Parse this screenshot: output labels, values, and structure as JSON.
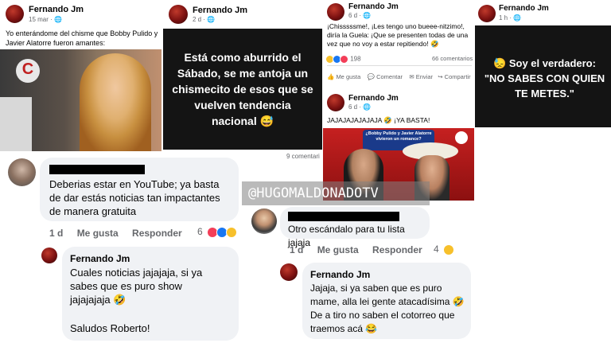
{
  "posts": {
    "p1": {
      "author": "Fernando Jm",
      "time": "15 mar · ",
      "text": "Yo enterándome del chisme que Bobby Pulido y Javier Alatorre fueron amantes:",
      "tv_logo": "C"
    },
    "p2": {
      "author": "Fernando Jm",
      "time": "2 d · ",
      "text": "Está como aburrido el Sábado, se me antoja un chismecito de esos que se vuelven tendencia nacional 😅",
      "footer": "9 comentari"
    },
    "p3": {
      "author": "Fernando Jm",
      "time": "6 d · ",
      "text": "¡Chisssssme!, ¡Les tengo uno bueee-nitzimo!, diría la Guela: ¡Que se presenten todas de una vez que no voy a estar repitiendo! 🤣",
      "reactions": "198",
      "comments": "66 comentarios",
      "actions": [
        "Me gusta",
        "Comentar",
        "Enviar",
        "Compartir"
      ]
    },
    "p4": {
      "author": "Fernando Jm",
      "time": "6 d · ",
      "text": "JAJAJAJAJAJAJA 🤣 ¡YA BASTA!",
      "thumb_caption": "¿Bobby Pulido y Javier Alatorre vivieron un romance?"
    },
    "p5": {
      "author": "Fernando Jm",
      "time": "1 h · ",
      "text": "😓 Soy el verdadero: \"NO SABES CON QUIEN TE METES.\""
    }
  },
  "watermark": "@HUGOMALDONADOTV",
  "comments": {
    "c1": {
      "text": "Deberias estar en YouTube; ya basta de dar estás noticias tan impactantes de manera gratuita",
      "time": "1 d",
      "like": "Me gusta",
      "reply": "Responder",
      "count": "6"
    },
    "r1": {
      "author": "Fernando Jm",
      "text": "Cuales noticias jajajaja, si ya sabes que es puro show jajajajaja 🤣",
      "text2": "Saludos Roberto!"
    },
    "c2": {
      "text": "Otro escándalo para tu lista jajaja",
      "time": "1 d",
      "like": "Me gusta",
      "reply": "Responder",
      "count": "4"
    },
    "r2": {
      "author": "Fernando Jm",
      "text": "Jajaja, si ya saben que es puro mame, alla lei gente atacadísima 🤣 De a tiro no saben el cotorreo que traemos acá 😂"
    }
  },
  "colors": {
    "dark_card": "#141414",
    "bubble": "#f0f2f5",
    "like_blue": "#1877f2",
    "haha_yellow": "#f7c02b",
    "love_red": "#f33e58"
  }
}
